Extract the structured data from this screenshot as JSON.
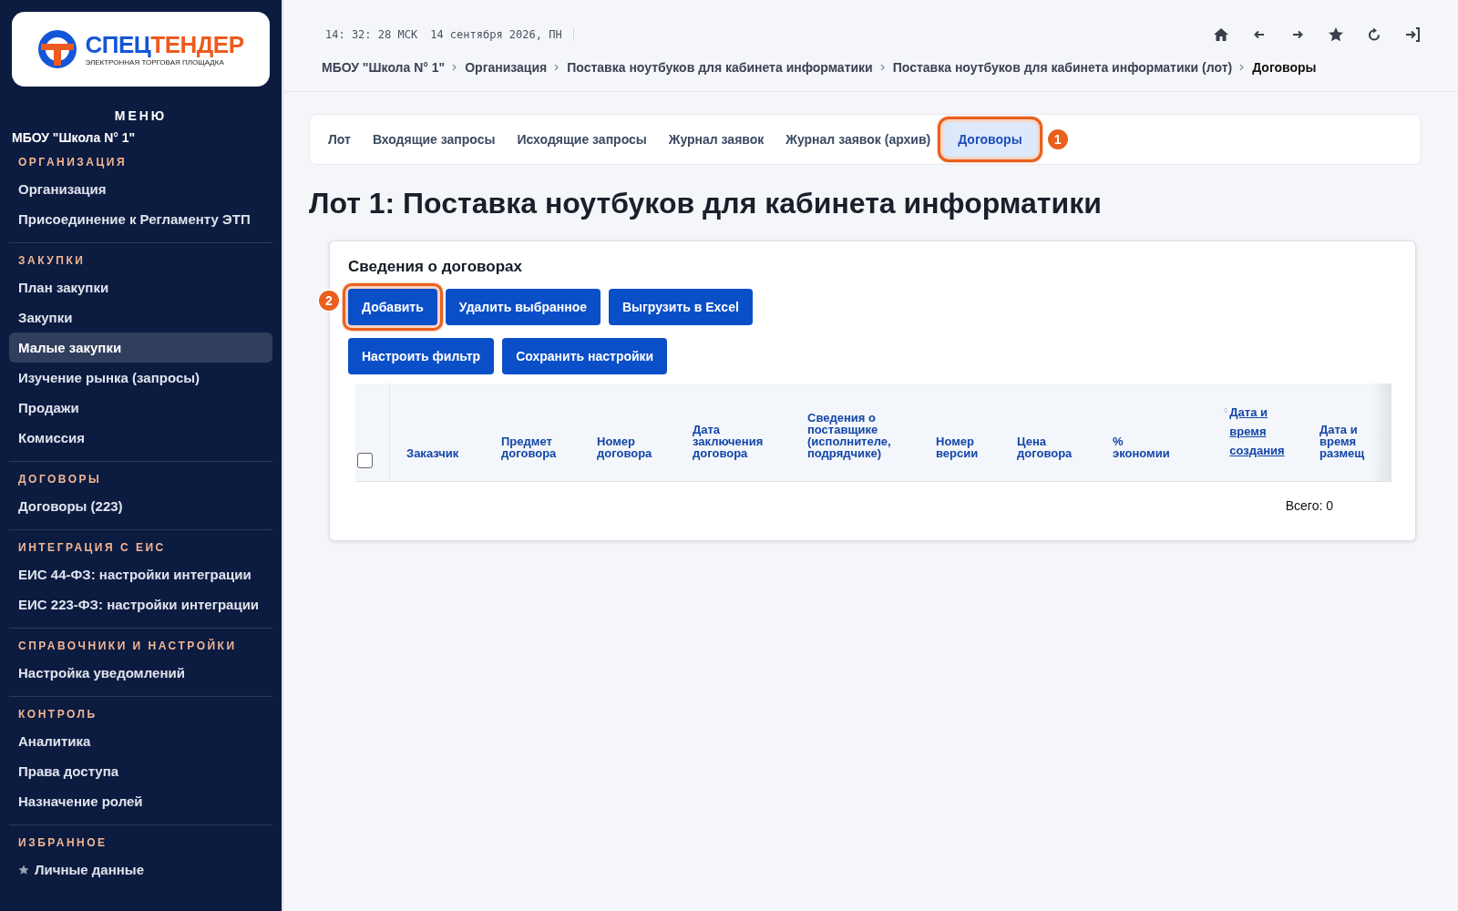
{
  "logo": {
    "name_part1": "СПЕЦ",
    "name_part2": "ТЕНДЕР",
    "tagline": "ЭЛЕКТРОННАЯ ТОРГОВАЯ ПЛОЩАДКА"
  },
  "sidebar": {
    "menu_title": "МЕНЮ",
    "organization": "МБОУ \"Школа N° 1\"",
    "sections": [
      {
        "title": "ОРГАНИЗАЦИЯ",
        "items": [
          {
            "label": "Организация",
            "selected": false
          },
          {
            "label": "Присоединение к Регламенту ЭТП",
            "selected": false
          }
        ]
      },
      {
        "title": "ЗАКУПКИ",
        "items": [
          {
            "label": "План закупки",
            "selected": false
          },
          {
            "label": "Закупки",
            "selected": false
          },
          {
            "label": "Малые закупки",
            "selected": true
          },
          {
            "label": "Изучение рынка (запросы)",
            "selected": false
          },
          {
            "label": "Продажи",
            "selected": false
          },
          {
            "label": "Комиссия",
            "selected": false
          }
        ]
      },
      {
        "title": "ДОГОВОРЫ",
        "items": [
          {
            "label": "Договоры (223)",
            "selected": false
          }
        ]
      },
      {
        "title": "ИНТЕГРАЦИЯ С ЕИС",
        "items": [
          {
            "label": "ЕИС 44-ФЗ: настройки интеграции",
            "selected": false
          },
          {
            "label": "ЕИС 223-ФЗ: настройки интеграции",
            "selected": false
          }
        ]
      },
      {
        "title": "СПРАВОЧНИКИ И НАСТРОЙКИ",
        "items": [
          {
            "label": "Настройка уведомлений",
            "selected": false
          }
        ]
      },
      {
        "title": "КОНТРОЛЬ",
        "items": [
          {
            "label": "Аналитика",
            "selected": false
          },
          {
            "label": "Права доступа",
            "selected": false
          },
          {
            "label": "Назначение ролей",
            "selected": false
          }
        ]
      },
      {
        "title": "ИЗБРАННОЕ",
        "items": [
          {
            "label": "Личные данные",
            "selected": false,
            "kind": "favorite"
          }
        ]
      }
    ]
  },
  "header": {
    "clock": "14: 32: 28 МСК",
    "date": "14 сентября 2026, ПН",
    "breadcrumbs": [
      "МБОУ \"Школа N° 1\"",
      "Организация",
      "Поставка ноутбуков для кабинета информатики",
      "Поставка ноутбуков для кабинета информатики (лот)",
      "Договоры"
    ]
  },
  "tabs": [
    {
      "label": "Лот",
      "selected": false
    },
    {
      "label": "Входящие запросы",
      "selected": false
    },
    {
      "label": "Исходящие запросы",
      "selected": false
    },
    {
      "label": "Журнал заявок",
      "selected": false
    },
    {
      "label": "Журнал заявок (архив)",
      "selected": false
    },
    {
      "label": "Договоры",
      "selected": true,
      "callout": "1"
    }
  ],
  "page_title": "Лот 1: Поставка ноутбуков для кабинета информатики",
  "panel": {
    "title": "Сведения о договорах",
    "buttons": [
      [
        {
          "label": "Добавить",
          "callout": "2"
        },
        {
          "label": "Удалить выбранное"
        },
        {
          "label": "Выгрузить в Excel"
        }
      ],
      [
        {
          "label": "Настроить фильтр"
        },
        {
          "label": "Сохранить настройки"
        }
      ]
    ],
    "table": {
      "select_all_checked": false,
      "columns": [
        {
          "label": "Заказчик",
          "sortable": false
        },
        {
          "label": "Предмет договора",
          "sortable": false
        },
        {
          "label": "Номер договора",
          "sortable": false
        },
        {
          "label": "Дата заключения договора",
          "sortable": false
        },
        {
          "label": "Сведения о поставщике (исполнителе, подрядчике)",
          "sortable": false
        },
        {
          "label": "Номер версии",
          "sortable": false
        },
        {
          "label": "Цена договора",
          "sortable": false
        },
        {
          "label": "% экономии",
          "sortable": false
        },
        {
          "label": "Дата и время создания",
          "sortable": true
        },
        {
          "label": "Дата и время размещ",
          "sortable": false
        }
      ]
    },
    "total": "Всего: 0"
  }
}
